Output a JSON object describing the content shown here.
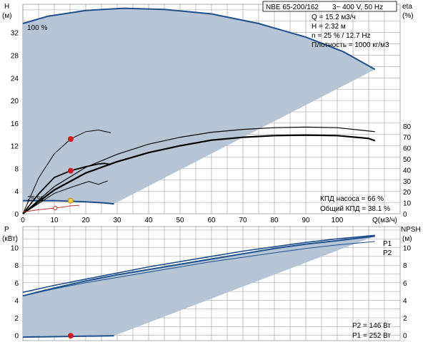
{
  "colors": {
    "background": "#ffffff",
    "grid": "#9a9a9a",
    "envelope_fill": "#b5c5d6",
    "envelope_edge": "#1f4f8a",
    "curve": "#000000",
    "blue_curve": "#1f4f8a",
    "marker_red": "#d21c1c",
    "marker_yellow": "#f3d43a",
    "npsh_line": "#b83232"
  },
  "legend_box": {
    "title": "NBE 65-200/162",
    "power": "3~ 400 V, 50 Hz",
    "q": "Q = 15.2 м3/ч",
    "h": "H = 2.32 м",
    "n": "n = 25 % / 12.7 Hz",
    "density": "Плотность = 1000 кг/м3"
  },
  "annotations": {
    "speed_max": "100 %",
    "speed_min": "25 %",
    "pump_eff": "КПД насоса = 66 %",
    "total_eff": "Общий КПД = 38.1 %",
    "p2": "P2 = 146 Вт",
    "p1": "P1 = 252 Вт"
  },
  "chart_data": [
    {
      "type": "line",
      "title": "",
      "xlabel": "Q(м3/ч)",
      "x_ticks": [
        0,
        10,
        20,
        30,
        40,
        50,
        60,
        70,
        80,
        90,
        100
      ],
      "xlim": [
        0,
        120
      ],
      "left_axis": {
        "label_top": "H",
        "label_unit": "(м)",
        "ylim": [
          0,
          37
        ],
        "ticks": [
          0,
          4,
          8,
          12,
          16,
          20,
          24,
          28,
          32
        ]
      },
      "right_axis": {
        "label_top": "eta",
        "label_unit": "(%)",
        "ylim": [
          0,
          80
        ],
        "ticks": [
          0,
          10,
          20,
          30,
          40,
          50,
          60,
          70,
          80
        ],
        "grid_h_max": 15.5
      },
      "grid": true,
      "envelope": {
        "upper_100pct": [
          [
            0,
            33.6
          ],
          [
            8,
            34.9
          ],
          [
            20,
            35.9
          ],
          [
            32,
            36.3
          ],
          [
            45,
            36.1
          ],
          [
            60,
            35.3
          ],
          [
            75,
            33.6
          ],
          [
            90,
            31.2
          ],
          [
            102,
            28.6
          ],
          [
            112,
            25.5
          ]
        ],
        "lower_25pct": [
          [
            0,
            2.3
          ],
          [
            10,
            2.32
          ],
          [
            20,
            2.12
          ],
          [
            26,
            1.9
          ],
          [
            29,
            1.75
          ]
        ]
      },
      "series": [
        {
          "role": "pump_efficiency",
          "points": [
            [
              0,
              0
            ],
            [
              10,
              4.2
            ],
            [
              20,
              7.2
            ],
            [
              30,
              9.2
            ],
            [
              40,
              10.8
            ],
            [
              50,
              12.0
            ],
            [
              60,
              13.0
            ],
            [
              70,
              13.5
            ],
            [
              80,
              13.8
            ],
            [
              90,
              13.9
            ],
            [
              100,
              13.8
            ],
            [
              110,
              13.3
            ],
            [
              112,
              12.9
            ]
          ]
        },
        {
          "role": "reference_efficiency",
          "points": [
            [
              0,
              0
            ],
            [
              10,
              4.8
            ],
            [
              20,
              8.2
            ],
            [
              30,
              10.5
            ],
            [
              40,
              12.3
            ],
            [
              50,
              13.5
            ],
            [
              60,
              14.4
            ],
            [
              70,
              14.9
            ],
            [
              80,
              15.2
            ],
            [
              90,
              15.3
            ],
            [
              100,
              15.2
            ],
            [
              112,
              14.5
            ]
          ]
        },
        {
          "role": "efficiency_25pct_band",
          "points": [
            [
              0,
              0
            ],
            [
              10,
              3.6
            ],
            [
              16,
              4.8
            ],
            [
              21,
              5.7
            ],
            [
              24,
              5.2
            ],
            [
              27,
              5.8
            ]
          ]
        },
        {
          "role": "efficiency_25pct_upper",
          "points": [
            [
              0,
              0
            ],
            [
              5,
              3.5
            ],
            [
              10,
              6.4
            ],
            [
              15.2,
              7.6
            ],
            [
              20,
              8.3
            ],
            [
              24,
              8.8
            ],
            [
              26,
              8.9
            ],
            [
              28,
              8.7
            ]
          ]
        },
        {
          "role": "efficiency_25pct_top",
          "points": [
            [
              0,
              0
            ],
            [
              5,
              6.3
            ],
            [
              10,
              10.6
            ],
            [
              15.2,
              13.2
            ],
            [
              20,
              14.5
            ],
            [
              24,
              14.8
            ],
            [
              28,
              14.3
            ]
          ]
        },
        {
          "role": "npsh_lower",
          "points": [
            [
              0,
              0.3
            ],
            [
              5,
              0.7
            ],
            [
              10,
              1.0
            ],
            [
              13,
              1.2
            ],
            [
              15.2,
              1.4
            ],
            [
              18,
              1.5
            ]
          ]
        }
      ],
      "markers": [
        {
          "x": 15.2,
          "y": 13.2,
          "kind": "red"
        },
        {
          "x": 15.2,
          "y": 7.6,
          "kind": "red"
        },
        {
          "x": 15.2,
          "y": 2.32,
          "kind": "yellow"
        },
        {
          "x": 10.3,
          "y": 1.0,
          "kind": "open"
        }
      ]
    },
    {
      "type": "line",
      "title": "",
      "xlabel": "",
      "xlim": [
        0,
        120
      ],
      "left_axis": {
        "label_top": "P",
        "label_unit": "(кВт)",
        "ylim": [
          -0.6,
          12.4
        ],
        "ticks": [
          0,
          2,
          4,
          6,
          8,
          10
        ]
      },
      "right_axis": {
        "label_top": "NPSH",
        "label_unit": "(м)",
        "ylim": [
          -0.6,
          12.4
        ],
        "ticks": [
          0,
          2,
          4,
          6,
          8,
          10
        ]
      },
      "grid": true,
      "envelope": {
        "upper_100pct": [
          [
            0,
            4.5
          ],
          [
            10,
            5.4
          ],
          [
            20,
            6.2
          ],
          [
            30,
            6.9
          ],
          [
            40,
            7.5
          ],
          [
            50,
            8.1
          ],
          [
            60,
            8.7
          ],
          [
            70,
            9.3
          ],
          [
            80,
            9.9
          ],
          [
            90,
            10.4
          ],
          [
            100,
            10.8
          ],
          [
            112,
            11.3
          ]
        ],
        "lower_25pct": [
          [
            0,
            -0.2
          ],
          [
            10,
            -0.15
          ],
          [
            20,
            -0.1
          ],
          [
            29,
            -0.05
          ]
        ]
      },
      "series": [
        {
          "name": "P1",
          "points": [
            [
              0,
              4.9
            ],
            [
              10,
              5.7
            ],
            [
              20,
              6.4
            ],
            [
              30,
              7.1
            ],
            [
              40,
              7.8
            ],
            [
              50,
              8.4
            ],
            [
              60,
              9.0
            ],
            [
              70,
              9.6
            ],
            [
              80,
              10.1
            ],
            [
              90,
              10.6
            ],
            [
              100,
              11.0
            ],
            [
              112,
              11.4
            ]
          ]
        },
        {
          "name": "P2",
          "points": [
            [
              0,
              4.5
            ],
            [
              10,
              5.3
            ],
            [
              20,
              6.0
            ],
            [
              30,
              6.6
            ],
            [
              40,
              7.2
            ],
            [
              50,
              7.8
            ],
            [
              60,
              8.4
            ],
            [
              70,
              8.9
            ],
            [
              80,
              9.4
            ],
            [
              90,
              9.9
            ],
            [
              100,
              10.3
            ],
            [
              112,
              10.7
            ]
          ]
        }
      ],
      "markers": [
        {
          "x": 15.2,
          "y": -0.05,
          "kind": "red"
        }
      ]
    }
  ]
}
